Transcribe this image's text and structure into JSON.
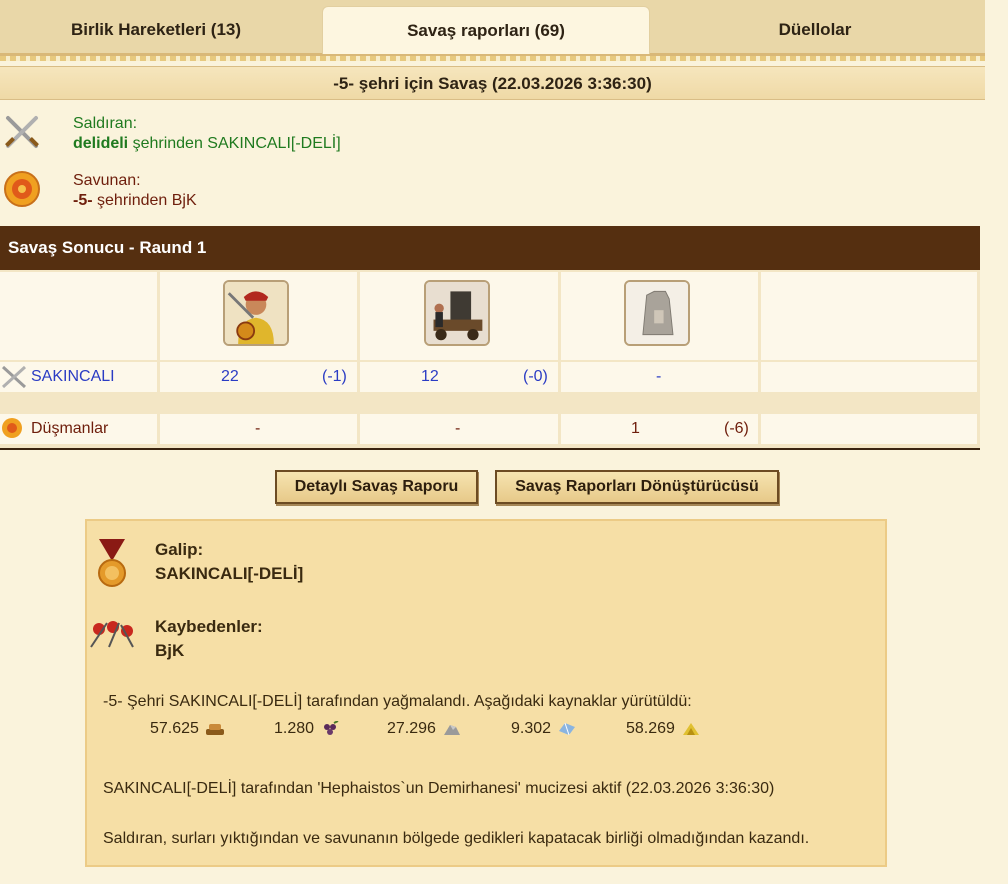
{
  "tabs": [
    {
      "label": "Birlik Hareketleri (13)"
    },
    {
      "label": "Savaş raporları (69)"
    },
    {
      "label": "Düellolar"
    }
  ],
  "report": {
    "title": "-5- şehri için Savaş (22.03.2026 3:36:30)",
    "attacker": {
      "label": "Saldıran:",
      "city": "delideli",
      "text": "şehrinden SAKINCALI[-DELİ]"
    },
    "defender": {
      "label": "Savunan:",
      "city": "-5-",
      "text": "şehrinden BjK"
    },
    "result_title": "Savaş Sonucu - Raund 1",
    "rows": [
      {
        "name": "SAKINCALI",
        "values": [
          {
            "count": "22",
            "loss": "(-1)"
          },
          {
            "count": "12",
            "loss": "(-0)"
          },
          {
            "count": "-",
            "loss": ""
          }
        ]
      },
      {
        "name": "Düşmanlar",
        "values": [
          {
            "count": "-",
            "loss": ""
          },
          {
            "count": "-",
            "loss": ""
          },
          {
            "count": "1",
            "loss": "(-6)"
          }
        ]
      }
    ]
  },
  "buttons": {
    "detailed": "Detaylı Savaş Raporu",
    "converter": "Savaş Raporları Dönüştürücüsü"
  },
  "summary": {
    "winner_label": "Galip:",
    "winner_name": "SAKINCALI[-DELİ]",
    "loser_label": "Kaybedenler:",
    "loser_name": "BjK",
    "plunder_text": "-5- Şehri SAKINCALI[-DELİ] tarafından yağmalandı. Aşağıdaki kaynaklar yürütüldü:",
    "resources": [
      {
        "value": "57.625",
        "icon": "wood-icon"
      },
      {
        "value": "1.280",
        "icon": "grapes-icon"
      },
      {
        "value": "27.296",
        "icon": "marble-icon"
      },
      {
        "value": "9.302",
        "icon": "crystal-icon"
      },
      {
        "value": "58.269",
        "icon": "sulfur-icon"
      }
    ],
    "wonder_text": "SAKINCALI[-DELİ] tarafından 'Hephaistos`un Demirhanesi' mucizesi aktif (22.03.2026 3:36:30)",
    "reason_text": "Saldıran, surları yıktığından ve savunanın bölgede gedikleri kapatacak birliği olmadığından kazandı."
  }
}
